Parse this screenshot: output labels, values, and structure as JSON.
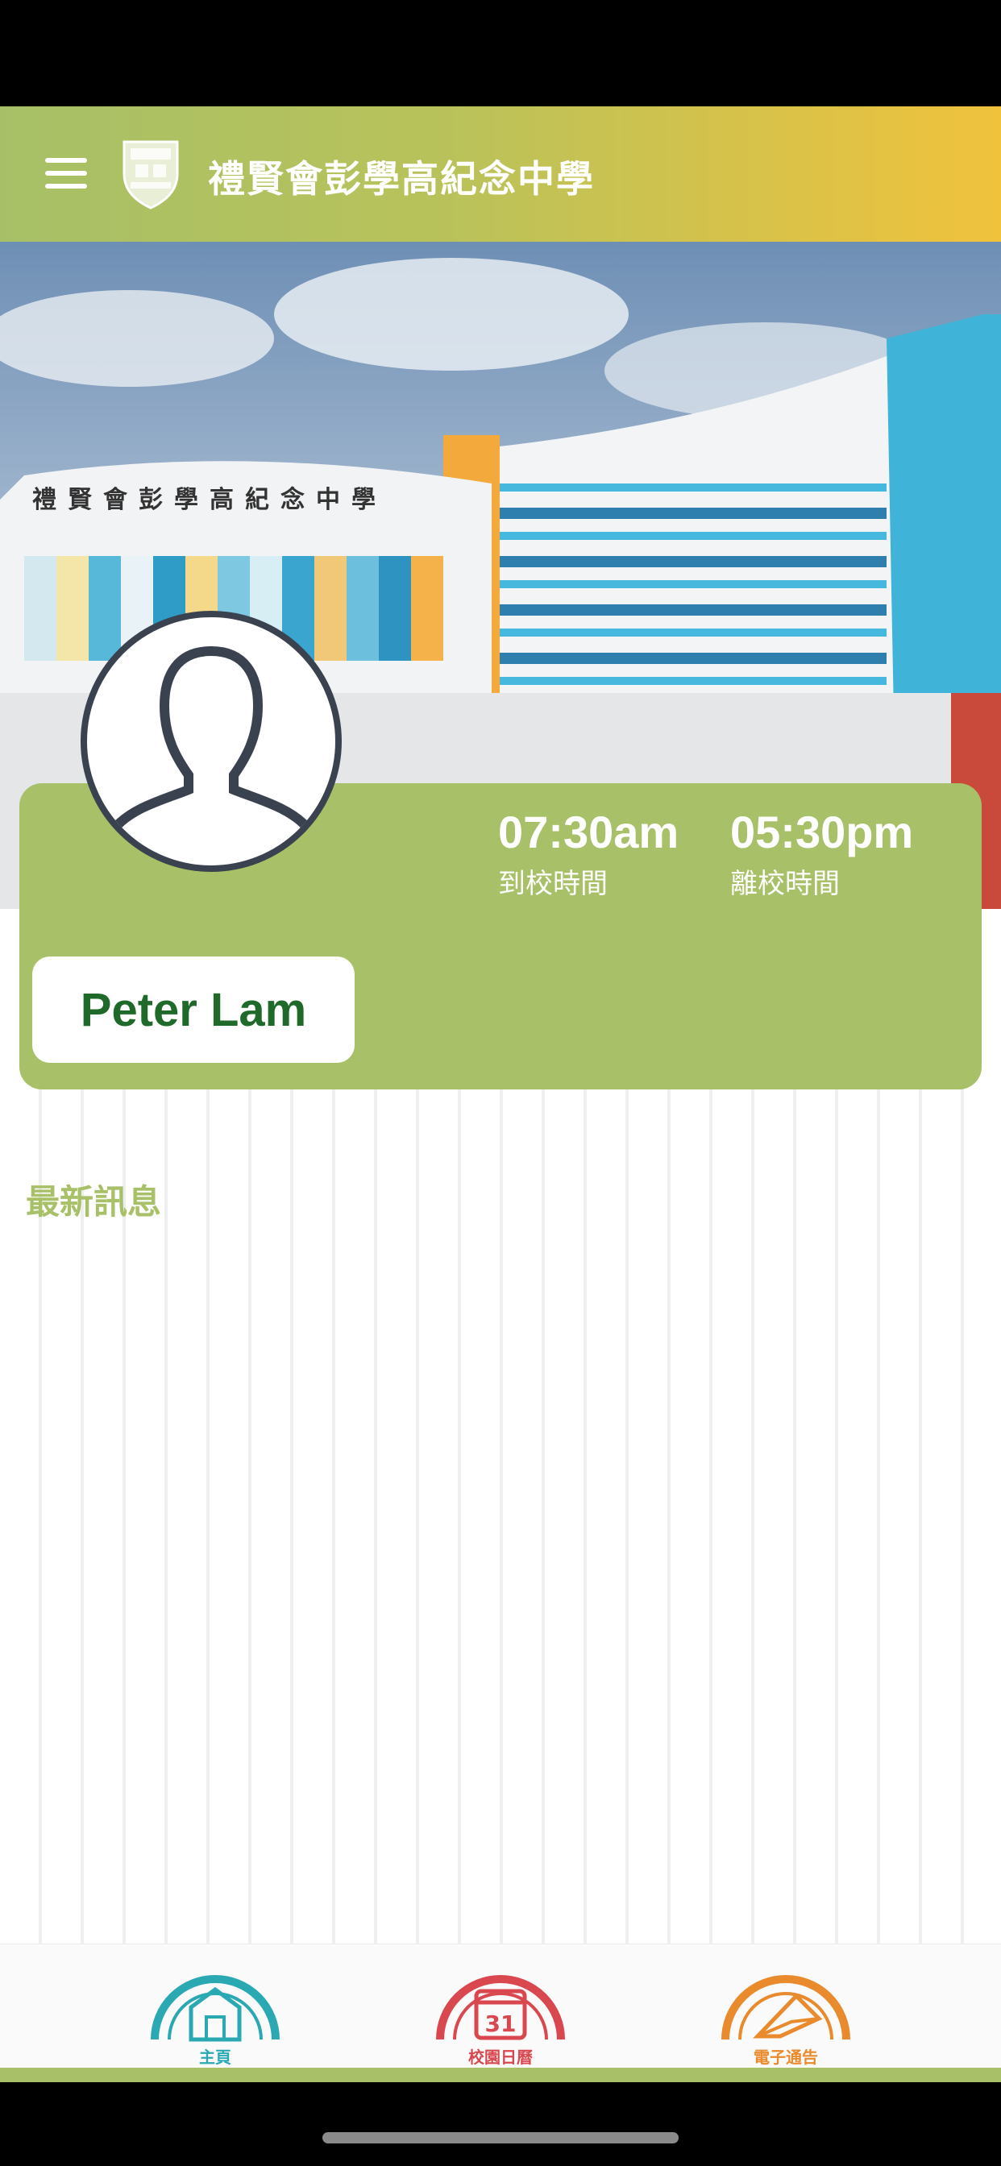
{
  "header": {
    "school_name": "禮賢會彭學高紀念中學",
    "menu_icon": "hamburger-menu-icon",
    "logo": "school-crest-logo"
  },
  "hero": {
    "building_sign": "禮賢會彭學高紀念中學"
  },
  "profile": {
    "name": "Peter Lam",
    "arrival_time": "07:30am",
    "arrival_label": "到校時間",
    "departure_time": "05:30pm",
    "departure_label": "離校時間",
    "avatar_icon": "person-silhouette-icon"
  },
  "news": {
    "heading": "最新訊息"
  },
  "bottom_nav": {
    "items": [
      {
        "label": "主頁",
        "icon": "school-building-icon",
        "color": "#2aa9b3"
      },
      {
        "label": "校園日曆",
        "icon": "calendar-icon",
        "day": "31",
        "color": "#d9474f"
      },
      {
        "label": "電子通告",
        "icon": "envelope-icon",
        "color": "#e98a2c"
      }
    ]
  },
  "colors": {
    "accent_green": "#a8c068",
    "name_green": "#1f6a2a",
    "header_gradient_end": "#f0c23c"
  }
}
